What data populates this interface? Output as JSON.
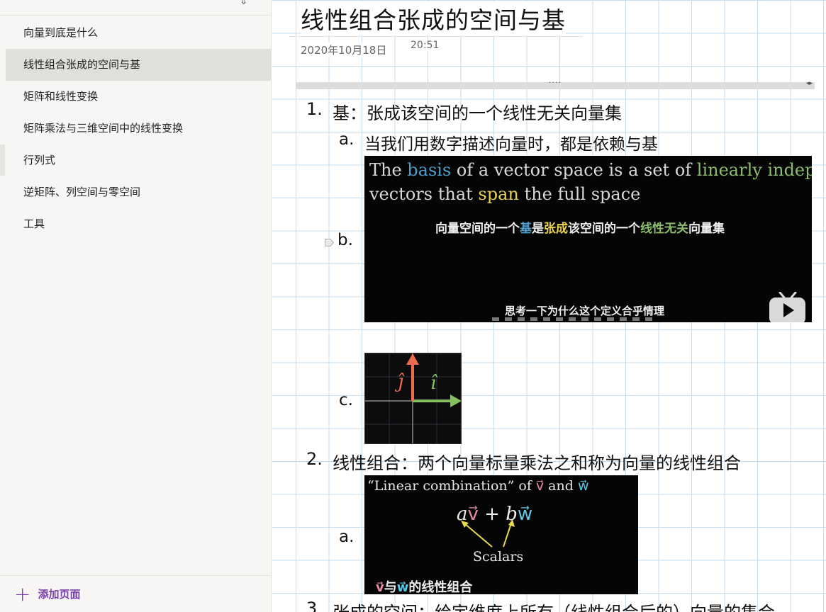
{
  "sidebar": {
    "pages": [
      {
        "label": "向量到底是什么",
        "active": false
      },
      {
        "label": "线性组合张成的空间与基",
        "active": true
      },
      {
        "label": "矩阵和线性变换",
        "active": false
      },
      {
        "label": "矩阵乘法与三维空间中的线性变换",
        "active": false
      },
      {
        "label": "行列式",
        "active": false
      },
      {
        "label": "逆矩阵、列空间与零空间",
        "active": false
      },
      {
        "label": "工具",
        "active": false
      }
    ],
    "add_page_icon": "plus-icon",
    "add_page_label": "添加页面"
  },
  "note": {
    "title": "线性组合张成的空间与基",
    "date": "2020年10月18日",
    "time": "20:51",
    "items": {
      "item1_num": "1.",
      "item1_text": "基：张成该空间的一个线性无关向量集",
      "item1a_num": "a.",
      "item1a_text": "当我们用数字描述向量时，都是依赖与基",
      "item1b_num": "b.",
      "item1c_num": "c.",
      "item2_num": "2.",
      "item2_text": "线性组合：两个向量标量乘法之和称为向量的线性组合",
      "item2a_num": "a.",
      "item3_num": "3.",
      "item3_text": "张成的空间：给定维度上所有（线性组合后的）向量的集合"
    },
    "video": {
      "line1_a": "The ",
      "line1_basis": "basis",
      "line1_b": " of a vector space is a set of ",
      "line1_li": "linearly independent",
      "line2_a": "vectors that ",
      "line2_span": "span",
      "line2_b": " the full space",
      "subtitle_a": "向量空间的一个",
      "subtitle_ji": "基",
      "subtitle_shi": "是",
      "subtitle_zhangcheng": "张成",
      "subtitle_b": "该空间的一个",
      "subtitle_wuguan": "线性无关",
      "subtitle_c": "向量集",
      "caption": "思考一下为什么这个定义合乎情理",
      "play_icon": "video-play-icon"
    },
    "axes_image": {
      "j_label": "ĵ",
      "i_label": "î"
    },
    "lincomb_image": {
      "header_a": "“Linear combination” of ",
      "header_v": "v⃗",
      "header_and": " and ",
      "header_w": "w⃗",
      "eq_a": "a",
      "eq_v": "v⃗",
      "eq_plus": " + ",
      "eq_b": "b",
      "eq_w": "w⃗",
      "scalars": "Scalars",
      "caption_v": "v⃗",
      "caption_mid": "与",
      "caption_w": "w⃗",
      "caption_end": "的线性组合"
    }
  },
  "colors": {
    "accent": "#7b3fb0",
    "basis_blue": "#4f9fcf",
    "independent_green": "#8cbd6d",
    "span_yellow": "#e9d24d",
    "v_pink": "#e58fa3",
    "w_cyan": "#5cc7e6",
    "grid": "#c6dcef"
  }
}
